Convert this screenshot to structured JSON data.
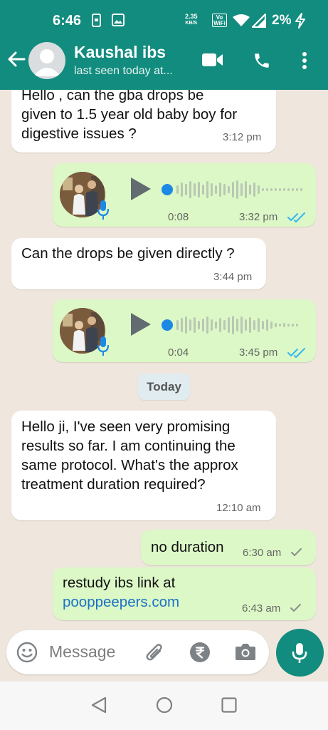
{
  "status_bar": {
    "time": "6:46",
    "net_speed_value": "2.35",
    "net_speed_unit": "KB/S",
    "volte_line1": "Vo",
    "volte_line2": "WiFi",
    "battery": "2%"
  },
  "app_bar": {
    "contact_name": "Kaushal ibs",
    "last_seen": "last seen today at..."
  },
  "messages": [
    {
      "direction": "incoming",
      "type": "text",
      "lines": [
        "Hello , can the gba drops be",
        "given to 1.5 year old baby boy for",
        "digestive issues ?"
      ],
      "time": "3:12 pm"
    },
    {
      "direction": "outgoing",
      "type": "voice",
      "duration": "0:08",
      "time": "3:32 pm",
      "status": "read"
    },
    {
      "direction": "incoming",
      "type": "text",
      "lines": [
        "Can the drops be given directly ?"
      ],
      "time": "3:44 pm"
    },
    {
      "direction": "outgoing",
      "type": "voice",
      "duration": "0:04",
      "time": "3:45 pm",
      "status": "read"
    },
    {
      "direction": "incoming",
      "type": "text",
      "lines": [
        "Hello ji, I've seen very promising",
        "results so far. I am continuing the",
        "same protocol. What's the approx",
        "treatment duration required?"
      ],
      "time": "12:10 am"
    },
    {
      "direction": "outgoing",
      "type": "text",
      "lines": [
        "no duration"
      ],
      "time": "6:30 am",
      "status": "sent"
    },
    {
      "direction": "outgoing",
      "type": "text",
      "lines": [
        "restudy ibs link at"
      ],
      "link": "pooppeepers.com",
      "time": "6:43 am",
      "status": "sent"
    }
  ],
  "day_separator": "Today",
  "composer": {
    "placeholder": "Message"
  },
  "colors": {
    "header": "#128c7e",
    "chat_background": "#efe7dd",
    "incoming_bubble": "#ffffff",
    "outgoing_bubble": "#dcf8c6",
    "read_ticks": "#34b7f1",
    "link": "#1b72c8",
    "voice_accent": "#1e88e5"
  }
}
